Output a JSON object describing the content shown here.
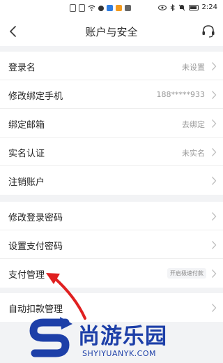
{
  "status_bar": {
    "time": "2:24",
    "icons": [
      "sim-icon",
      "signal-icon",
      "wifi-icon",
      "chat-icon",
      "app-icon-1",
      "app-icon-2",
      "app-icon-3",
      "eye-icon",
      "bluetooth-icon",
      "mute-icon",
      "battery-icon"
    ]
  },
  "header": {
    "title": "账户与安全",
    "back_icon": "chevron-left-icon",
    "support_icon": "headset-icon"
  },
  "groups": [
    {
      "rows": [
        {
          "label": "登录名",
          "value": "未设置"
        },
        {
          "label": "修改绑定手机",
          "value": "188*****933"
        },
        {
          "label": "绑定邮箱",
          "value": "去绑定"
        },
        {
          "label": "实名认证",
          "value": "未实名"
        },
        {
          "label": "注销账户",
          "value": ""
        }
      ]
    },
    {
      "rows": [
        {
          "label": "修改登录密码",
          "value": ""
        },
        {
          "label": "设置支付密码",
          "value": ""
        },
        {
          "label": "支付管理",
          "badge": "开启极速付款"
        }
      ]
    },
    {
      "rows": [
        {
          "label": "自动扣款管理",
          "value": ""
        }
      ]
    }
  ],
  "watermark": {
    "text_cn": "尚游乐园",
    "text_en": "SHYIYUANYK.COM"
  },
  "colors": {
    "accent_arrow": "#e02020",
    "watermark_blue": "#1d3fa8",
    "background": "#f2f3f5"
  }
}
